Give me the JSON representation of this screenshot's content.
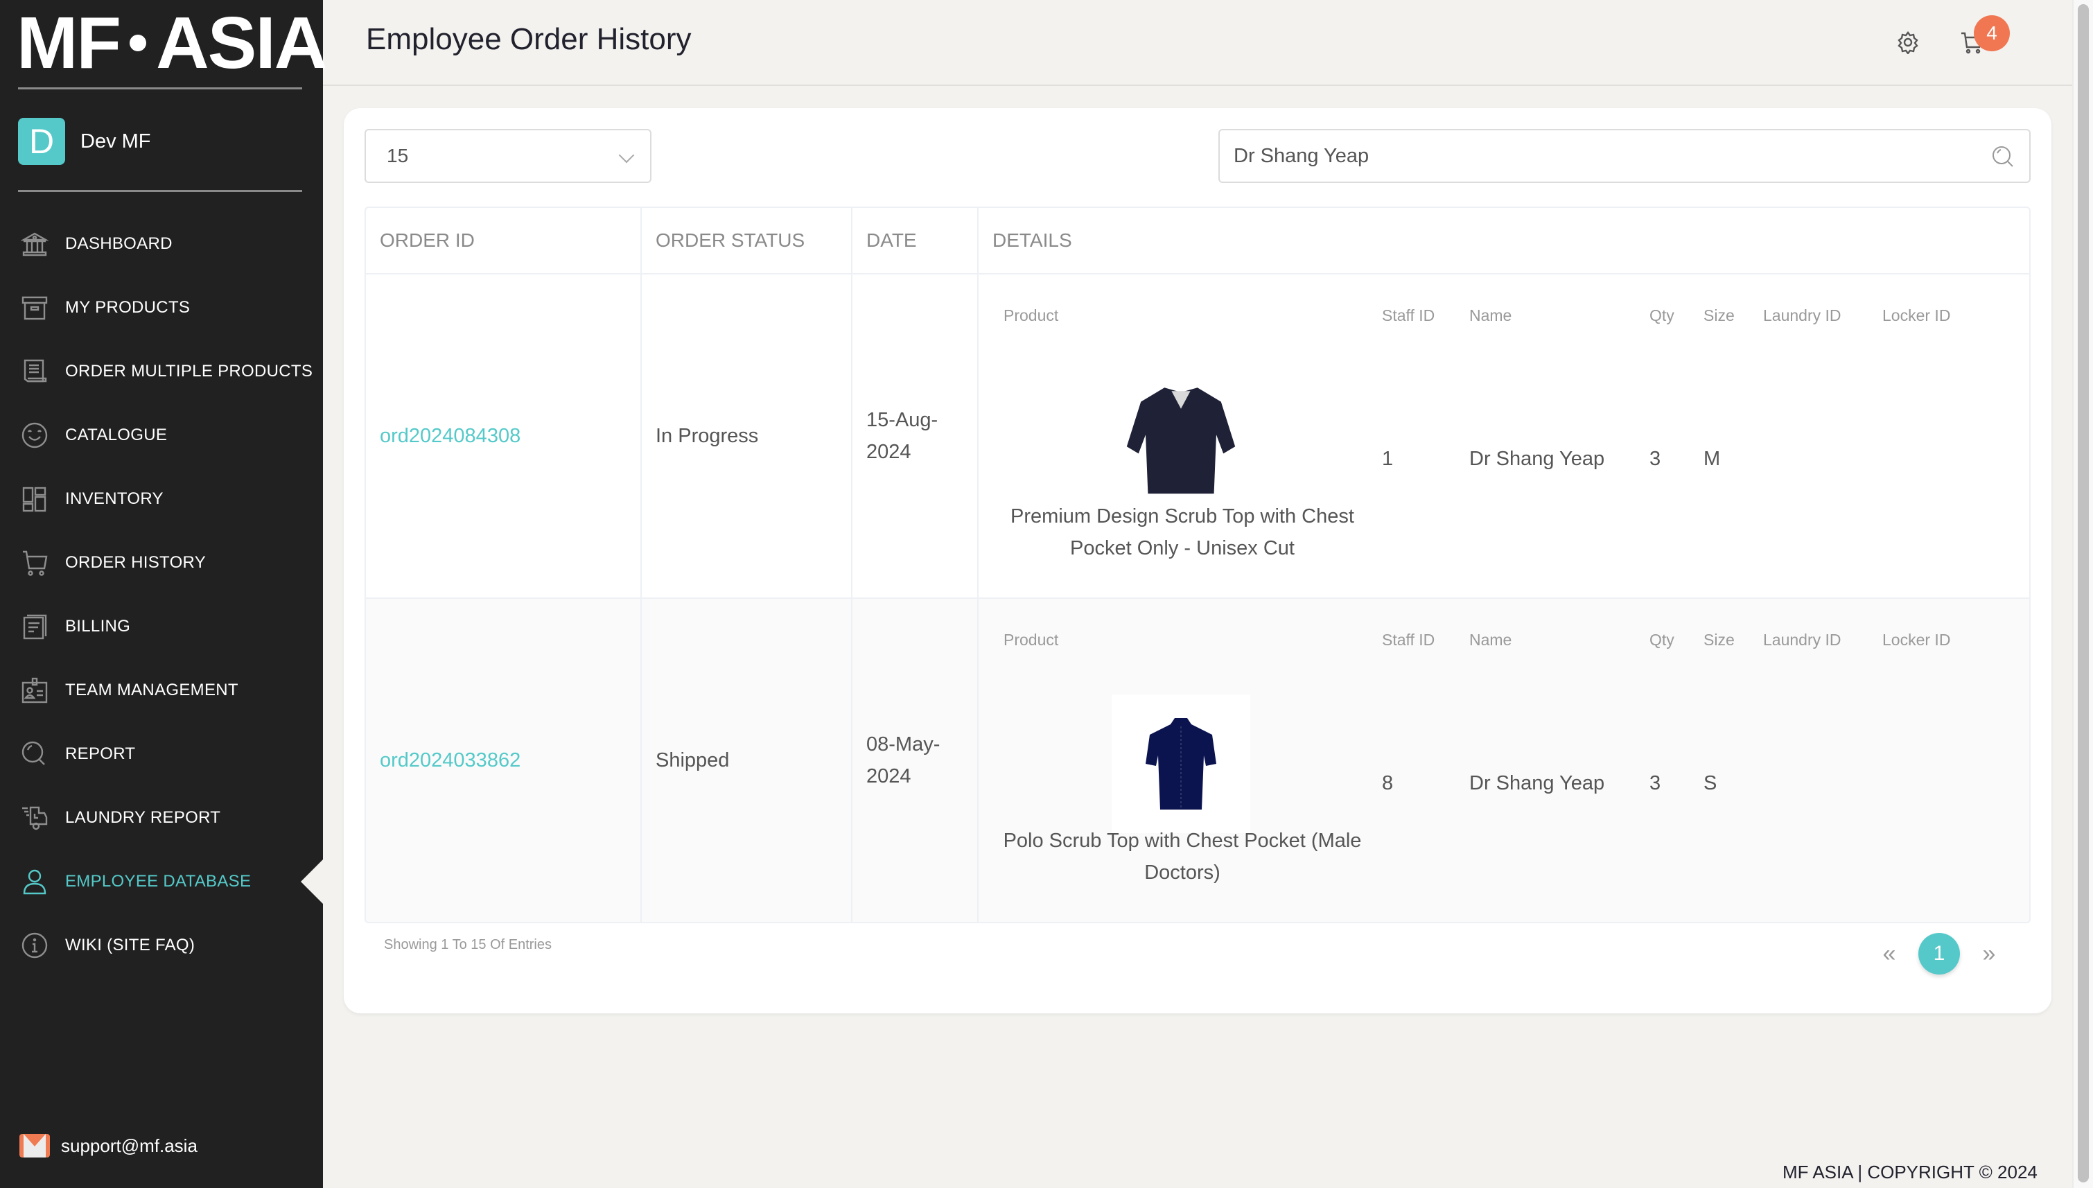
{
  "brand": {
    "logo_left": "MF",
    "logo_right": "ASIA"
  },
  "user": {
    "initial": "D",
    "name": "Dev MF"
  },
  "sidebar": {
    "items": [
      {
        "label": "DASHBOARD",
        "icon": "bank-icon",
        "active": false
      },
      {
        "label": "MY PRODUCTS",
        "icon": "archive-box-icon",
        "active": false
      },
      {
        "label": "ORDER MULTIPLE PRODUCTS",
        "icon": "receipt-icon",
        "active": false
      },
      {
        "label": "CATALOGUE",
        "icon": "smiley-icon",
        "active": false
      },
      {
        "label": "INVENTORY",
        "icon": "layout-grid-icon",
        "active": false
      },
      {
        "label": "ORDER HISTORY",
        "icon": "cart-icon",
        "active": false
      },
      {
        "label": "BILLING",
        "icon": "document-icon",
        "active": false
      },
      {
        "label": "TEAM MANAGEMENT",
        "icon": "id-badge-icon",
        "active": false
      },
      {
        "label": "REPORT",
        "icon": "magnifier-icon",
        "active": false
      },
      {
        "label": "LAUNDRY REPORT",
        "icon": "delivery-truck-icon",
        "active": false
      },
      {
        "label": "EMPLOYEE DATABASE",
        "icon": "user-icon",
        "active": true
      },
      {
        "label": "WIKI (SITE FAQ)",
        "icon": "info-icon",
        "active": false
      }
    ],
    "support_email": "support@mf.asia"
  },
  "header": {
    "title": "Employee Order History",
    "cart_count": "4"
  },
  "controls": {
    "page_size": "15",
    "search_value": "Dr Shang Yeap"
  },
  "table": {
    "columns": [
      "ORDER ID",
      "ORDER STATUS",
      "DATE",
      "DETAILS"
    ],
    "detail_columns": [
      "Product",
      "Staff ID",
      "Name",
      "Qty",
      "Size",
      "Laundry ID",
      "Locker ID"
    ],
    "rows": [
      {
        "order_id": "ord2024084308",
        "status": "In Progress",
        "date_line1": "15-Aug-",
        "date_line2": "2024",
        "product": "Premium Design Scrub Top with Chest Pocket Only - Unisex Cut",
        "staff_id": "1",
        "name": "Dr Shang Yeap",
        "qty": "3",
        "size": "M",
        "laundry_id": "",
        "locker_id": ""
      },
      {
        "order_id": "ord2024033862",
        "status": "Shipped",
        "date_line1": "08-May-",
        "date_line2": "2024",
        "product": "Polo Scrub Top with Chest Pocket (Male Doctors)",
        "staff_id": "8",
        "name": "Dr Shang Yeap",
        "qty": "3",
        "size": "S",
        "laundry_id": "",
        "locker_id": ""
      }
    ]
  },
  "pagination": {
    "showing": "Showing 1 To 15 Of Entries",
    "prev": "«",
    "current": "1",
    "next": "»"
  },
  "footer": {
    "text": "MF ASIA | COPYRIGHT © 2024"
  },
  "colors": {
    "accent": "#55c9c9",
    "badge": "#f07752",
    "sidebar_bg": "#212121"
  }
}
